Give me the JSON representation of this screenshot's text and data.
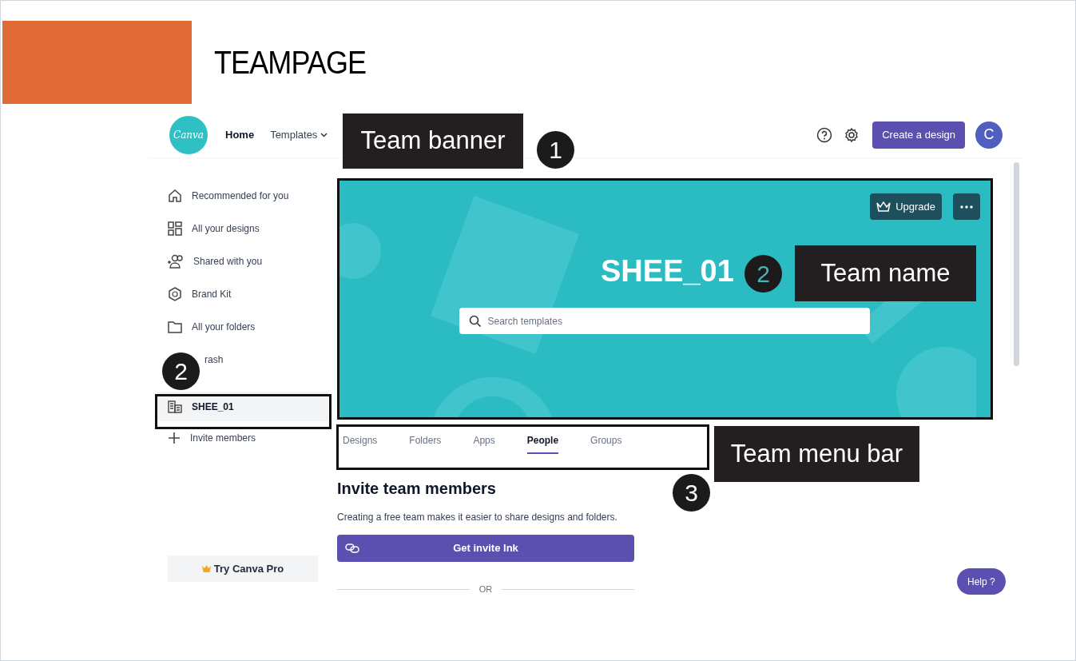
{
  "slide": {
    "title": "TEAMPAGE"
  },
  "header": {
    "logo": "Canva",
    "nav": [
      {
        "label": "Home",
        "selected": true
      },
      {
        "label": "Templates",
        "selected": false
      }
    ],
    "create_button": "Create a design",
    "avatar": "C"
  },
  "sidebar": {
    "items": [
      {
        "label": "Recommended for you",
        "selected": false
      },
      {
        "label": "All your designs",
        "selected": false
      },
      {
        "label": "Shared with you",
        "selected": false
      },
      {
        "label": "Brand Kit",
        "selected": false
      },
      {
        "label": "All your folders",
        "selected": false
      },
      {
        "label": "rash",
        "selected": false
      },
      {
        "label": "SHEE_01",
        "selected": true
      },
      {
        "label": "Invite members",
        "selected": false
      }
    ],
    "try_pro": "Try Canva Pro"
  },
  "banner": {
    "upgrade": "Upgrade",
    "team_name": "SHEE_01",
    "search": {
      "placeholder": "Search templates"
    }
  },
  "tabs": [
    {
      "label": "Designs",
      "selected": false
    },
    {
      "label": "Folders",
      "selected": false
    },
    {
      "label": "Apps",
      "selected": false
    },
    {
      "label": "People",
      "selected": true
    },
    {
      "label": "Groups",
      "selected": false
    }
  ],
  "invite": {
    "heading": "Invite team members",
    "text": "Creating a free team makes it easier to share designs and folders.",
    "button": "Get invite lnk",
    "divider": "OR"
  },
  "help": "Help ?",
  "callouts": [
    {
      "text": "Team banner"
    },
    {
      "text": "Team name"
    },
    {
      "text": "Team menu bar"
    }
  ],
  "badges": [
    {
      "number": "1"
    },
    {
      "number": "2"
    },
    {
      "number": "2"
    },
    {
      "number": "3"
    }
  ]
}
